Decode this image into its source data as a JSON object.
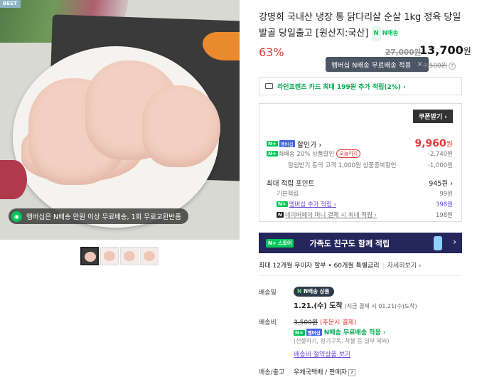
{
  "hero": {
    "best_badge": "BEST",
    "promo_text": "멤버십은 N배송 만원 이상 무료배송, 1회 무료교환반품"
  },
  "thumbnails": [
    "thumb-1",
    "thumb-2",
    "thumb-3",
    "thumb-4"
  ],
  "product": {
    "title": "강명희 국내산 냉장 통 닭다리살 순살 1kg 정육 당일발골 당일출고 [원산지:국산]",
    "delivery_badge": "N배송",
    "discount": "63%",
    "original_price": "27,000원",
    "price_value": "13,700",
    "price_unit": "원"
  },
  "tooltip": {
    "text": "멤버십 N배송 무료배송 적용",
    "close": "×"
  },
  "shipping_original": "3,500원",
  "card_promo": "라인프렌즈 카드 최대 199원 추가 적립(2%) ›",
  "benefit": {
    "coupon_button": "쿠폰받기 ›",
    "discount_label": "할인가 ›",
    "discount_value": "9,960",
    "discount_unit": "원",
    "nship_label": "N배송 20% 상품할인",
    "nship_tag": "오늘까지",
    "nship_value": "-2,740원",
    "first_label": "알림받기 동의 고객 1,000원 상품중복할인",
    "first_value": "-1,000원",
    "max_label": "최대 적립 포인트",
    "max_value": "945원 ›",
    "basic_label": "기본적립",
    "basic_value": "99원",
    "member_label": "멤버십 추가 적립 ›",
    "member_value": "398원",
    "npay_label": "네이버페이 머니 결제 시 최대 적립 ›",
    "npay_value": "198원"
  },
  "banner": {
    "store_tag": "N+ 스토어",
    "text": "가족도 친구도 함께 적립",
    "arrow": "›"
  },
  "installment": {
    "text": "최대 12개월 무이자 할부 • 60개월 특별금리",
    "more": "자세히보기 ›"
  },
  "shipping": {
    "label_ship": "배송일",
    "badge": "N배송 상품",
    "arrive": "1.21.(수) 도착",
    "arrive_note": "(지금 결제 시 01.21(수)도착)",
    "label_fee": "배송비",
    "fee_orig": "3,500원",
    "fee_pay": "(주문시 결제)",
    "fee_free": "N배송 무료배송 적용 ›",
    "fee_note": "(선물하기, 정기구독, 착불 등 일부 제외)",
    "fee_link": "배송비 절약상품 보기",
    "label_courier": "배송/출고",
    "courier": "우체국택배 / 판매자"
  },
  "colors": {
    "accent_green": "#03c75a",
    "discount_red": "#e33b3b",
    "banner_navy": "#24275c"
  }
}
